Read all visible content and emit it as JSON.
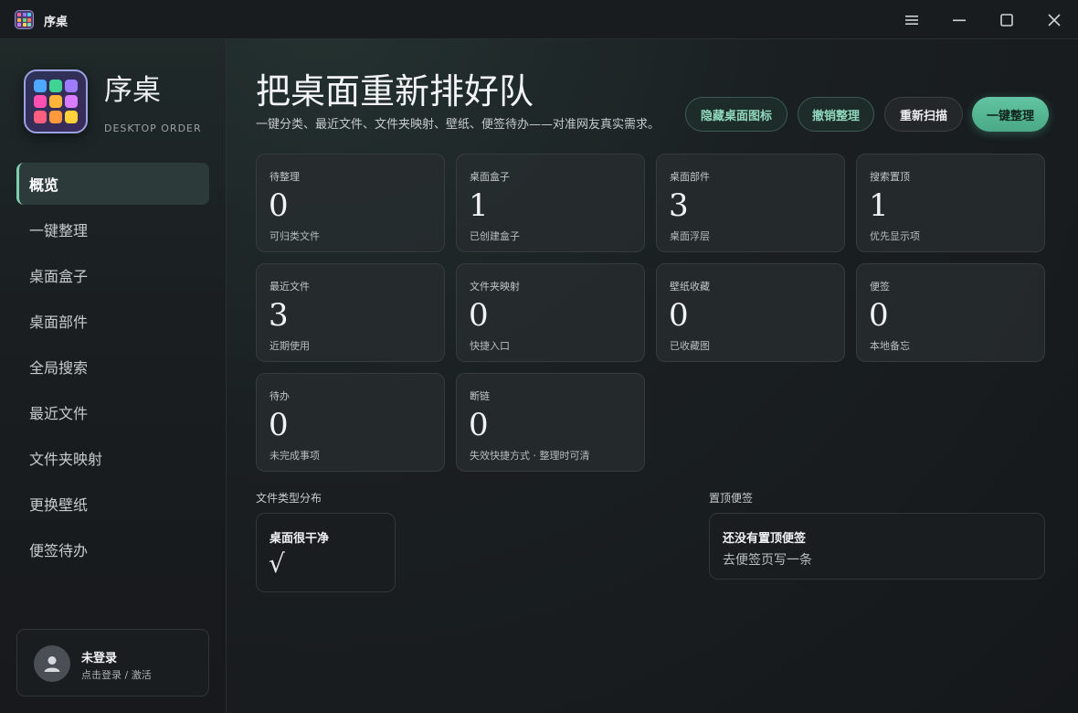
{
  "window": {
    "title": "序桌"
  },
  "brand": {
    "name": "序桌",
    "subtitle": "DESKTOP ORDER"
  },
  "nav": [
    {
      "label": "概览",
      "active": true
    },
    {
      "label": "一键整理"
    },
    {
      "label": "桌面盒子"
    },
    {
      "label": "桌面部件"
    },
    {
      "label": "全局搜索"
    },
    {
      "label": "最近文件"
    },
    {
      "label": "文件夹映射"
    },
    {
      "label": "更换壁纸"
    },
    {
      "label": "便签待办"
    }
  ],
  "user": {
    "name": "未登录",
    "hint": "点击登录 / 激活"
  },
  "header": {
    "title": "把桌面重新排好队",
    "subtitle": "一键分类、最近文件、文件夹映射、壁纸、便签待办——对准网友真实需求。"
  },
  "actions": {
    "hide_icons": "隐藏桌面图标",
    "undo": "撤销整理",
    "rescan": "重新扫描",
    "organize": "一键整理"
  },
  "stats": [
    {
      "label": "待整理",
      "value": "0",
      "desc": "可归类文件"
    },
    {
      "label": "桌面盒子",
      "value": "1",
      "desc": "已创建盒子"
    },
    {
      "label": "桌面部件",
      "value": "3",
      "desc": "桌面浮层"
    },
    {
      "label": "搜索置顶",
      "value": "1",
      "desc": "优先显示项"
    },
    {
      "label": "最近文件",
      "value": "3",
      "desc": "近期使用"
    },
    {
      "label": "文件夹映射",
      "value": "0",
      "desc": "快捷入口"
    },
    {
      "label": "壁纸收藏",
      "value": "0",
      "desc": "已收藏图"
    },
    {
      "label": "便签",
      "value": "0",
      "desc": "本地备忘"
    },
    {
      "label": "待办",
      "value": "0",
      "desc": "未完成事项"
    },
    {
      "label": "断链",
      "value": "0",
      "desc": "失效快捷方式 · 整理时可清"
    }
  ],
  "file_types": {
    "section": "文件类型分布",
    "title": "桌面很干净",
    "mark": "√"
  },
  "pinned_notes": {
    "section": "置顶便签",
    "title": "还没有置顶便签",
    "body": "去便签页写一条"
  },
  "colors": {
    "accent": "#62c4a2",
    "accent_text": "#8fd8bd"
  },
  "icons": {
    "menu": "hamburger-icon",
    "minimize": "minimize-icon",
    "maximize": "maximize-icon",
    "close": "close-icon",
    "avatar": "user-icon"
  }
}
